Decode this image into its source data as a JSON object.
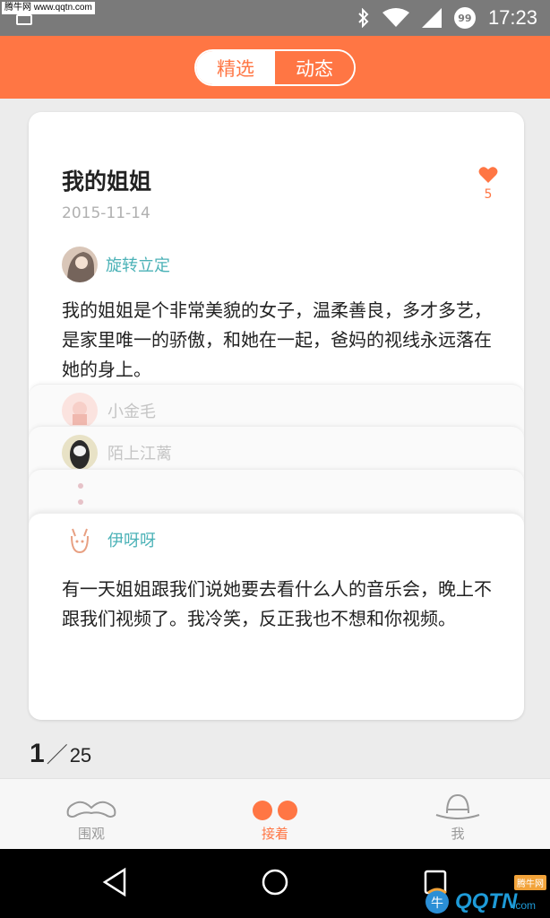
{
  "status_bar": {
    "watermark": "腾牛网 www.qqtn.com",
    "time": "17:23",
    "notification_count": "99"
  },
  "header": {
    "tabs": [
      {
        "label": "精选",
        "active": false
      },
      {
        "label": "动态",
        "active": true
      }
    ]
  },
  "story": {
    "title": "我的姐姐",
    "date": "2015-11-14",
    "likes": "5",
    "author": "旋转立定",
    "text": "我的姐姐是个非常美貌的女子，温柔善良，多才多艺，是家里唯一的骄傲，和她在一起，爸妈的视线永远落在她的身上。"
  },
  "replies": {
    "collapsed": [
      {
        "author": "小金毛"
      },
      {
        "author": "陌上江蓠"
      }
    ],
    "latest": {
      "author": "伊呀呀",
      "text": "有一天姐姐跟我们说她要去看什么人的音乐会，晚上不跟我们视频了。我冷笑，反正我也不想和你视频。"
    }
  },
  "pager": {
    "current": "1",
    "separator": "／",
    "total": "25"
  },
  "tabbar": {
    "items": [
      {
        "label": "围观",
        "icon": "mustache-icon",
        "active": false
      },
      {
        "label": "接着",
        "icon": "two-dots-icon",
        "active": true
      },
      {
        "label": "我",
        "icon": "bowler-hat-icon",
        "active": false
      }
    ]
  },
  "watermark_corner": {
    "logo": "QQTN",
    "suffix": ".com",
    "tag": "腾牛网"
  },
  "colors": {
    "accent": "#ff7644",
    "author_link": "#4bb2b7",
    "status_bar": "#7a7a7a"
  }
}
